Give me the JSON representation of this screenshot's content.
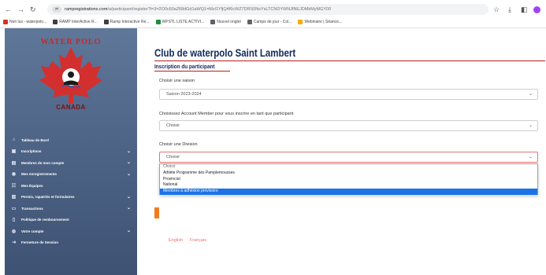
{
  "browser": {
    "url_prefix": "rampregistrations.com",
    "url_rest": "/a/participant/register?l=3=2O0c60a258dGd1aWQ1=Mzl1YfjQ4f6cWZ7DRS0NsYsLTCNDYWNJfNEJDMkMyMGY00",
    "bookmarks": [
      {
        "label": "Non lus - waterpolo...",
        "color": "#d93025"
      },
      {
        "label": "RAMP InterActive R...",
        "color": "#3c4043"
      },
      {
        "label": "Ramp Interactive Re...",
        "color": "#3c4043"
      },
      {
        "label": "WPSTL LISTE ACTIVI...",
        "color": "#1e8e3e"
      },
      {
        "label": "Nouvel onglet",
        "color": "#5f6368"
      },
      {
        "label": "Camps de jour - Col...",
        "color": "#5f6368"
      },
      {
        "label": "Webinaire | Séance...",
        "color": "#f9ab00"
      }
    ]
  },
  "sidebar": {
    "logo_top": "WATER POLO",
    "logo_bottom": "CANADA",
    "items": [
      {
        "label": "Tableau de Bord",
        "icon": "home-icon",
        "glyph": "⌂",
        "chevron": false
      },
      {
        "label": "Inscriptions",
        "icon": "display-icon",
        "glyph": "▣",
        "chevron": true
      },
      {
        "label": "Membres de mon compte",
        "icon": "id-card-icon",
        "glyph": "▤",
        "chevron": true
      },
      {
        "label": "Mes enregistrements",
        "icon": "user-circle-icon",
        "glyph": "◉",
        "chevron": true
      },
      {
        "label": "Mes Équipes",
        "icon": "group-icon",
        "glyph": "☷",
        "chevron": false
      },
      {
        "label": "Permis, rapatriés et formulaires",
        "icon": "document-icon",
        "glyph": "▥",
        "chevron": true
      },
      {
        "label": "Transactions",
        "icon": "card-icon",
        "glyph": "▭",
        "chevron": true
      },
      {
        "label": "Politique de remboursement",
        "icon": "receipt-icon",
        "glyph": "▯",
        "chevron": false
      },
      {
        "label": "Votre compte",
        "icon": "account-icon",
        "glyph": "◍",
        "chevron": true
      },
      {
        "label": "Fermeture de Session",
        "icon": "logout-icon",
        "glyph": "⇥",
        "chevron": false
      }
    ]
  },
  "main": {
    "title": "Club de waterpolo Saint Lambert",
    "subtitle": "Inscription du participant",
    "season_label": "Choisir une saison",
    "season_value": "Saison 2023-2024",
    "account_label": "Choisissez Account Member pour vous inscrire en tant que participant",
    "account_value": "Choisir",
    "division_label": "Choisir une Division",
    "division_value": "Choisir",
    "division_options": [
      "Choisir",
      "Athlète Programme des Pamplemousses",
      "Provincial",
      "National",
      "Membres à adhésion provisoire"
    ],
    "selected_option_index": 4,
    "lang_en": "English",
    "lang_fr": "Français"
  },
  "colors": {
    "accent_red": "#b71c1c",
    "title_navy": "#0e2a5c",
    "selected_blue": "#1a73e8",
    "orange": "#ef7d20"
  }
}
